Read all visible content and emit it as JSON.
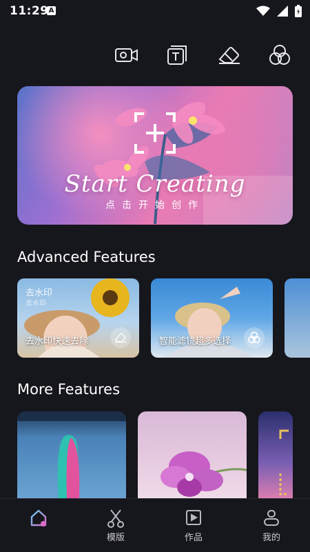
{
  "status_bar": {
    "time": "11:29",
    "notification_badge": "A"
  },
  "toolbar": {
    "icons": [
      "video-camera-icon",
      "text-box-icon",
      "eraser-icon",
      "filter-circles-icon"
    ]
  },
  "hero": {
    "title_en": "Start Creating",
    "title_cn": "点击开始创作"
  },
  "advanced": {
    "title": "Advanced Features",
    "cards": [
      {
        "label": "去水印快速去除",
        "watermark": "去水印",
        "watermark_small": "去水印",
        "icon": "eraser-icon"
      },
      {
        "label": "智能滤镜超多选择",
        "icon": "filter-circles-icon"
      }
    ]
  },
  "more": {
    "title": "More Features"
  },
  "bottom_nav": {
    "items": [
      {
        "label": "",
        "icon": "home-icon",
        "active": true
      },
      {
        "label": "模版",
        "icon": "scissors-icon"
      },
      {
        "label": "作品",
        "icon": "play-square-icon"
      },
      {
        "label": "我的",
        "icon": "user-icon"
      }
    ]
  }
}
